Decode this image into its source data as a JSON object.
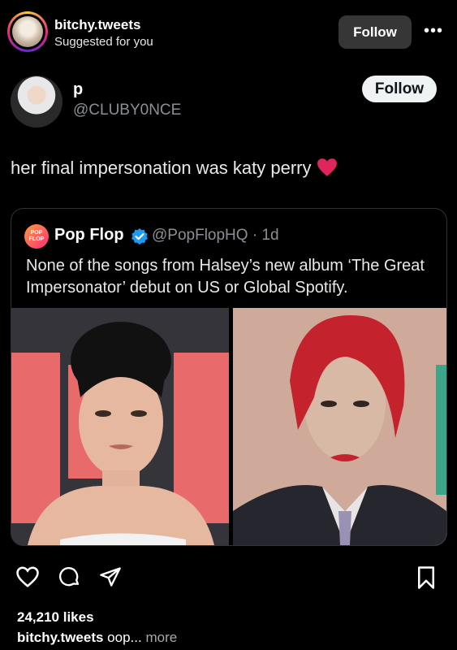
{
  "header": {
    "username": "bitchy.tweets",
    "subtitle": "Suggested for you",
    "follow_label": "Follow",
    "more_label": "•••"
  },
  "tweet": {
    "name": "p",
    "handle": "@CLUBY0NCE",
    "follow_label": "Follow",
    "text": "her final impersonation was katy perry",
    "emoji": "red-heart-emoji",
    "quote": {
      "logo_text": "POP FLOP",
      "name": "Pop Flop",
      "verified_icon": "verified-badge-icon",
      "handle_time": "@PopFlopHQ · 1d",
      "text": "None of the songs from Halsey’s new album ‘The Great Impersonator’ debut on US or Global Spotify."
    }
  },
  "actions": {
    "icons": [
      "heart-icon",
      "comment-icon",
      "share-icon",
      "bookmark-icon"
    ]
  },
  "likes": "24,210 likes",
  "caption": {
    "username": "bitchy.tweets",
    "text": "oop...",
    "more": "more"
  },
  "colors": {
    "background": "#000000",
    "follow_dark_bg": "#363636",
    "verified": "#1d9bf0",
    "heart": "#e0245e",
    "muted": "#8b8f94"
  }
}
